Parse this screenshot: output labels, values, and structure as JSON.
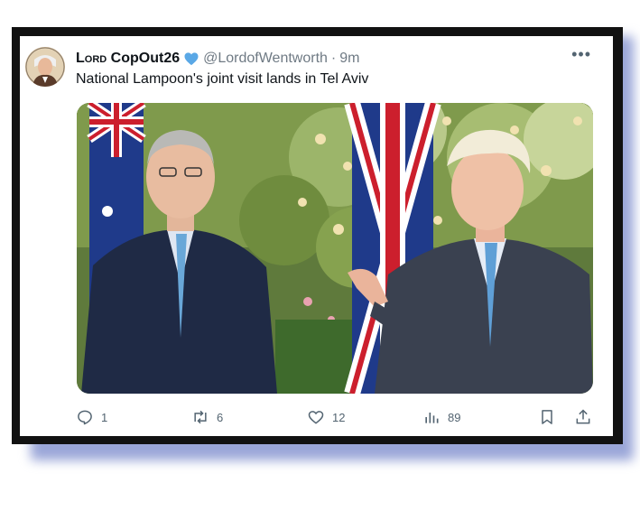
{
  "tweet": {
    "display_name_prefix": "Lord",
    "display_name_suffix": "CopOut26",
    "verified": true,
    "handle": "@LordofWentworth",
    "separator": "·",
    "time": "9m",
    "text": "National Lampoon's joint visit lands in Tel Aviv",
    "more_label": "•••"
  },
  "actions": {
    "replies": "1",
    "reposts": "6",
    "likes": "12",
    "views": "89"
  },
  "icons": {
    "verified": "verified-badge-icon",
    "reply": "reply-icon",
    "repost": "repost-icon",
    "like": "heart-icon",
    "views": "views-icon",
    "bookmark": "bookmark-icon",
    "share": "share-icon"
  },
  "colors": {
    "verified_blue": "#5aa8e6",
    "muted": "#536471",
    "frame": "#111111",
    "glow": "#9aa6d8"
  }
}
